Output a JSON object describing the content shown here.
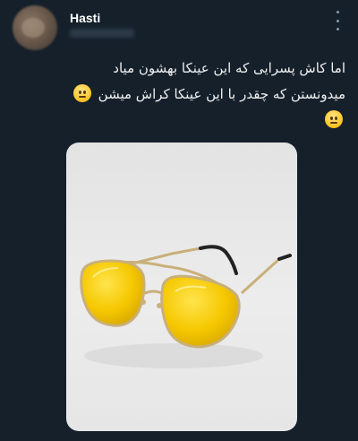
{
  "tweet": {
    "author_name": "Hasti",
    "text_line1": "اما کاش پسرایی که این عینکا بهشون میاد",
    "text_line2": "میدونستن که چقدر با این عینکا کراش میشن",
    "emoji": "neutral-face-emoji"
  },
  "colors": {
    "background": "#15202b",
    "text": "#f0f0f0",
    "lens": "#f2c300",
    "frame": "#c9b07a"
  }
}
